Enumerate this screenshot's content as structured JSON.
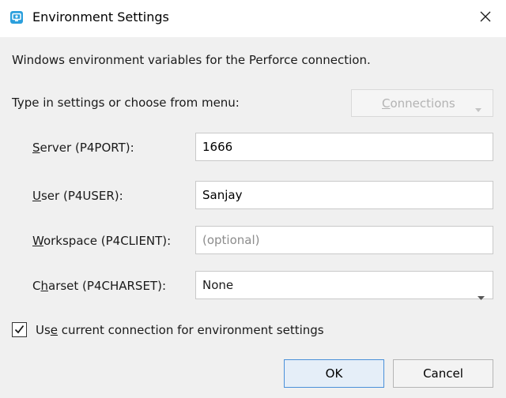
{
  "window": {
    "title": "Environment Settings"
  },
  "description": "Windows environment variables for the Perforce connection.",
  "instructions": "Type in settings or choose from menu:",
  "connections_button": {
    "prefix": "",
    "mnemonic": "C",
    "rest": "onnections",
    "enabled": false
  },
  "fields": {
    "server": {
      "label_mnemonic": "S",
      "label_rest": "erver (P4PORT):",
      "value": "1666"
    },
    "user": {
      "label_mnemonic": "U",
      "label_rest": "ser (P4USER):",
      "value": "Sanjay"
    },
    "workspace": {
      "label_mnemonic": "W",
      "label_rest": "orkspace (P4CLIENT):",
      "value": "",
      "placeholder": "(optional)"
    },
    "charset": {
      "label_prefix": "C",
      "label_mnemonic": "h",
      "label_rest": "arset (P4CHARSET):",
      "value": "None"
    }
  },
  "use_current": {
    "checked": true,
    "label_prefix": "Us",
    "label_mnemonic": "e",
    "label_rest": " current connection for environment settings"
  },
  "buttons": {
    "ok": "OK",
    "cancel": "Cancel"
  },
  "icons": {
    "app": "perforce-app-icon",
    "close": "close-icon",
    "dropdown": "chevron-down-icon",
    "check": "checkmark-icon"
  },
  "colors": {
    "accent": "#2b9fdc",
    "ok_border": "#4a90d9",
    "disabled_text": "#b3b3b3"
  }
}
